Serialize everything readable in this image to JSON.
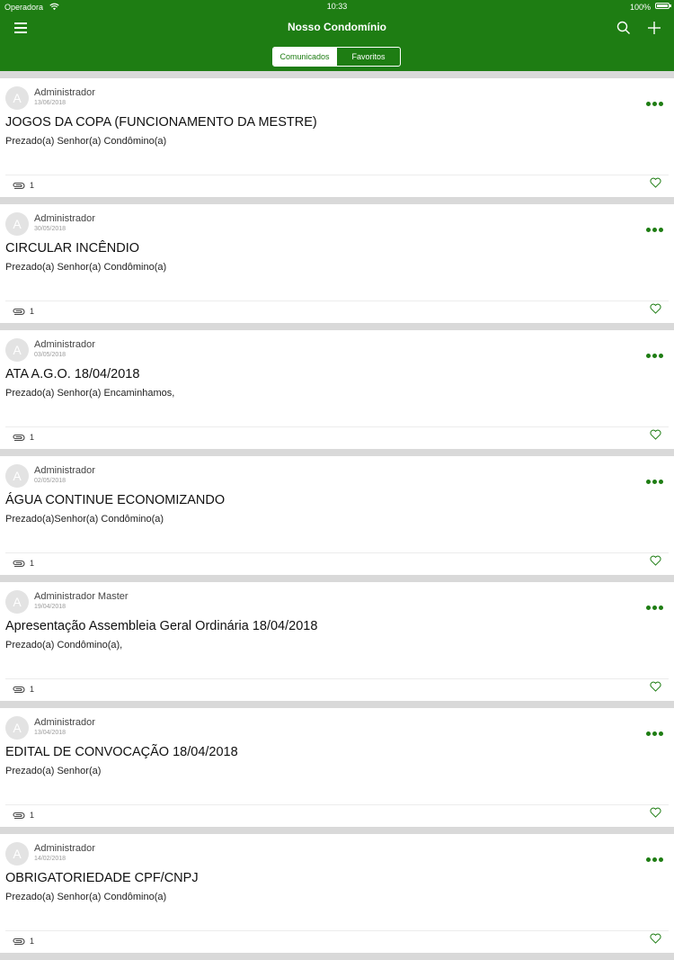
{
  "status_bar": {
    "carrier": "Operadora",
    "time": "10:33",
    "battery": "100%"
  },
  "header": {
    "title": "Nosso Condomínio"
  },
  "tabs": [
    {
      "label": "Comunicados",
      "active": true
    },
    {
      "label": "Favoritos",
      "active": false
    }
  ],
  "posts": [
    {
      "author": "Administrador",
      "avatar_letter": "A",
      "date": "13/06/2018",
      "title": "JOGOS DA COPA (FUNCIONAMENTO DA MESTRE)",
      "preview": "Prezado(a) Senhor(a) Condômino(a)",
      "attachments": "1"
    },
    {
      "author": "Administrador",
      "avatar_letter": "A",
      "date": "30/05/2018",
      "title": "CIRCULAR INCÊNDIO",
      "preview": "Prezado(a) Senhor(a) Condômino(a)",
      "attachments": "1"
    },
    {
      "author": "Administrador",
      "avatar_letter": "A",
      "date": "03/05/2018",
      "title": "ATA A.G.O. 18/04/2018",
      "preview": "Prezado(a) Senhor(a) Encaminhamos,",
      "attachments": "1"
    },
    {
      "author": "Administrador",
      "avatar_letter": "A",
      "date": "02/05/2018",
      "title": "ÁGUA CONTINUE ECONOMIZANDO",
      "preview": "Prezado(a)Senhor(a) Condômino(a)",
      "attachments": "1"
    },
    {
      "author": "Administrador Master",
      "avatar_letter": "A",
      "date": "19/04/2018",
      "title": "Apresentação Assembleia Geral Ordinária 18/04/2018",
      "preview": "Prezado(a) Condômino(a),",
      "attachments": "1"
    },
    {
      "author": "Administrador",
      "avatar_letter": "A",
      "date": "13/04/2018",
      "title": "EDITAL DE CONVOCAÇÃO 18/04/2018",
      "preview": "Prezado(a) Senhor(a)",
      "attachments": "1"
    },
    {
      "author": "Administrador",
      "avatar_letter": "A",
      "date": "14/02/2018",
      "title": "OBRIGATORIEDADE CPF/CNPJ",
      "preview": "Prezado(a) Senhor(a) Condômino(a)",
      "attachments": "1"
    }
  ],
  "colors": {
    "brand_green": "#1e7d13",
    "background": "#d9d9d9",
    "card": "#ffffff"
  },
  "icons": [
    "menu-icon",
    "search-icon",
    "add-icon",
    "more-icon",
    "attachment-icon",
    "heart-icon",
    "wifi-icon",
    "battery-icon"
  ]
}
